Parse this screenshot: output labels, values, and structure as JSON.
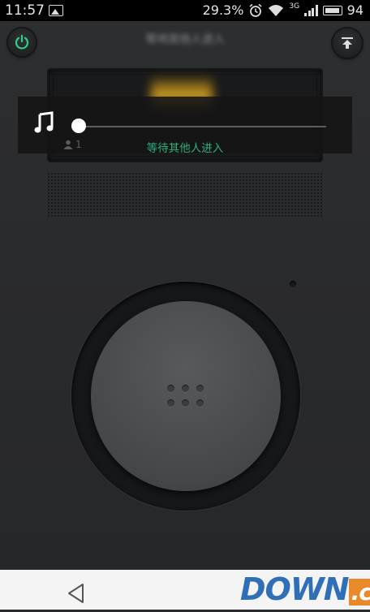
{
  "status_bar": {
    "time": "11:57",
    "battery_percent": "29.3%",
    "network_type": "3G",
    "battery_level": "94"
  },
  "header": {
    "title": "等待其他人进入",
    "power_icon": "power-icon",
    "upload_icon": "upload-icon"
  },
  "player": {
    "music_icon": "music-note-icon",
    "person_count": "1",
    "status_text": "等待其他人进入",
    "slider_position": 0
  },
  "nav": {
    "back_icon": "back-icon"
  },
  "watermark": {
    "down": "DOWN",
    "cc": ".cc"
  },
  "colors": {
    "accent_green": "#2bb07a",
    "background": "#2a2b2d"
  }
}
